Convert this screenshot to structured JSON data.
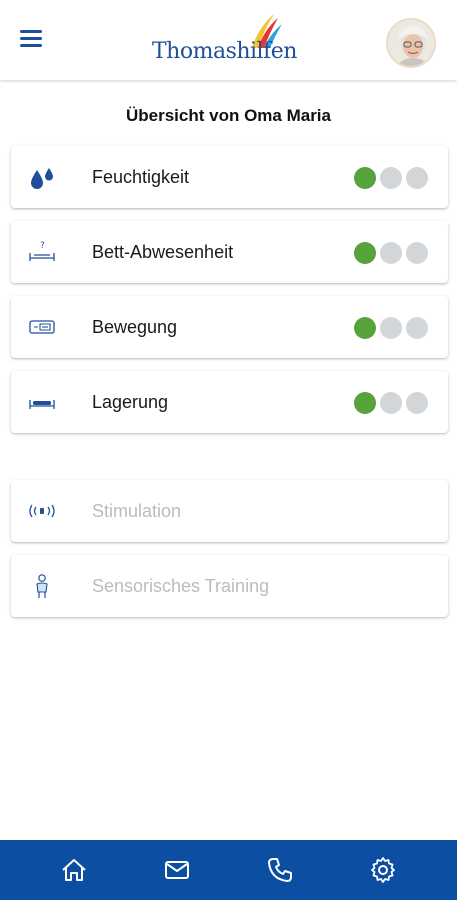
{
  "header": {
    "logo_text": "Thomashilfen",
    "menu_icon": "hamburger-menu-icon",
    "avatar": "user-avatar-photo"
  },
  "page": {
    "title": "Übersicht von Oma Maria"
  },
  "status_cards": [
    {
      "label": "Feuchtigkeit",
      "icon": "water-drops-icon",
      "level": 1,
      "max": 3
    },
    {
      "label": "Bett-Abwesenheit",
      "icon": "bed-question-icon",
      "level": 1,
      "max": 3
    },
    {
      "label": "Bewegung",
      "icon": "movement-sensor-icon",
      "level": 1,
      "max": 3
    },
    {
      "label": "Lagerung",
      "icon": "bed-position-icon",
      "level": 1,
      "max": 3
    }
  ],
  "feature_cards": [
    {
      "label": "Stimulation",
      "icon": "vibration-icon",
      "enabled": false
    },
    {
      "label": "Sensorisches Training",
      "icon": "person-training-icon",
      "enabled": false
    }
  ],
  "bottom_nav": [
    {
      "icon": "home-icon"
    },
    {
      "icon": "mail-icon"
    },
    {
      "icon": "phone-icon"
    },
    {
      "icon": "settings-gear-icon"
    }
  ],
  "colors": {
    "brand_blue": "#0b4ea2",
    "active_dot": "#57a33b",
    "inactive_dot": "#d3d6d9",
    "disabled_text": "#b9bcc0"
  }
}
